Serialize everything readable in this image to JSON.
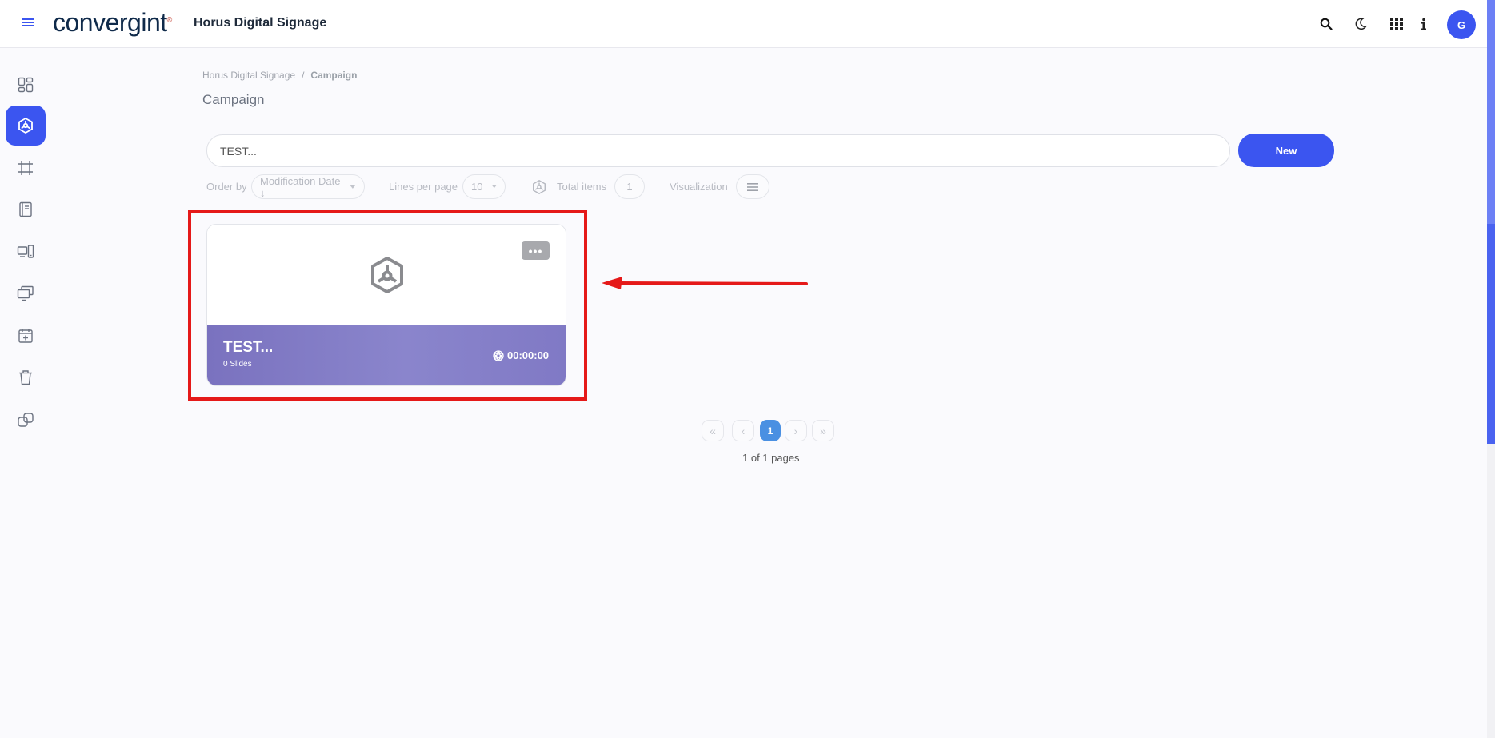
{
  "header": {
    "logo_text": "convergint",
    "logo_mark": "®",
    "app_title": "Horus Digital Signage",
    "menu_icon": "hamburger-icon",
    "search_icon": "search-icon",
    "theme_icon": "moon-icon",
    "apps_icon": "grid-icon",
    "info_icon": "info-icon",
    "avatar_initial": "G"
  },
  "sidebar": {
    "items": [
      {
        "icon": "dashboard-icon",
        "active": false
      },
      {
        "icon": "campaign-icon",
        "active": true
      },
      {
        "icon": "frame-icon",
        "active": false
      },
      {
        "icon": "book-icon",
        "active": false
      },
      {
        "icon": "devices-icon",
        "active": false
      },
      {
        "icon": "screens-icon",
        "active": false
      },
      {
        "icon": "calendar-add-icon",
        "active": false
      },
      {
        "icon": "trash-icon",
        "active": false
      },
      {
        "icon": "link-icon",
        "active": false
      }
    ]
  },
  "breadcrumb": {
    "root": "Horus Digital Signage",
    "separator": "/",
    "current": "Campaign"
  },
  "page": {
    "title": "Campaign"
  },
  "search": {
    "value": "TEST..."
  },
  "toolbar": {
    "new_label": "New"
  },
  "filters": {
    "order_by_label": "Order by",
    "order_by_value": "Modification Date ↓",
    "lines_label": "Lines per page",
    "lines_value": "10",
    "total_label": "Total items",
    "total_value": "1",
    "visualization_label": "Visualization"
  },
  "card": {
    "name": "TEST...",
    "slides": "0 Slides",
    "duration": "00:00:00",
    "more": "•••"
  },
  "pagination": {
    "first": "«",
    "prev": "‹",
    "current": "1",
    "next": "›",
    "last": "»",
    "info": "1 of 1 pages"
  },
  "colors": {
    "accent": "#3b55f0",
    "highlight": "#e51919",
    "card_footer": "#8079c5",
    "page_active": "#4a90e2"
  }
}
